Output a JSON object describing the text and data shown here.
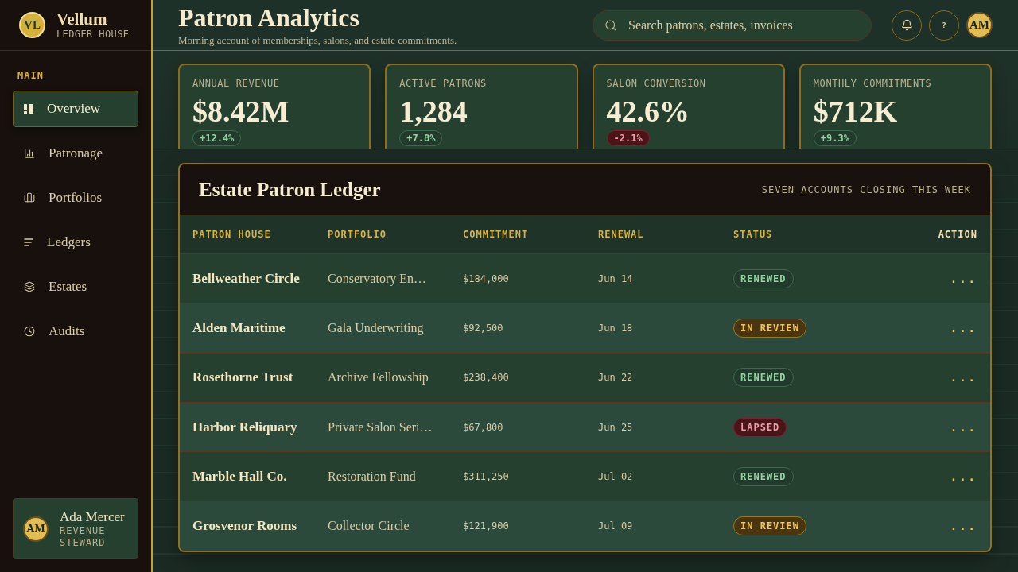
{
  "sidebar": {
    "logo": {
      "initials": "VL",
      "name": "Vellum",
      "tagline": "LEDGER HOUSE"
    },
    "section_label": "MAIN",
    "items": [
      {
        "label": "Overview",
        "selected": true
      },
      {
        "label": "Patronage",
        "selected": false
      },
      {
        "label": "Portfolios",
        "selected": false
      },
      {
        "label": "Ledgers",
        "selected": false
      },
      {
        "label": "Estates",
        "selected": false
      },
      {
        "label": "Audits",
        "selected": false
      }
    ],
    "user": {
      "initials": "AM",
      "name": "Ada Mercer",
      "role": "REVENUE STEWARD"
    }
  },
  "header": {
    "title": "Patron Analytics",
    "subtitle": "Morning account of memberships, salons, and estate commitments.",
    "search": {
      "placeholder": "Search patrons, estates, invoices"
    },
    "help_label": "?",
    "avatar_initials": "AM"
  },
  "kpis": [
    {
      "label": "ANNUAL REVENUE",
      "value": "$8.42M",
      "delta": {
        "text": "+12.4%",
        "kind": "up"
      }
    },
    {
      "label": "ACTIVE PATRONS",
      "value": "1,284",
      "delta": {
        "text": "+7.8%",
        "kind": "up"
      }
    },
    {
      "label": "SALON CONVERSION",
      "value": "42.6%",
      "delta": {
        "text": "-2.1%",
        "kind": "down"
      }
    },
    {
      "label": "MONTHLY COMMITMENTS",
      "value": "$712K",
      "delta": {
        "text": "+9.3%",
        "kind": "up"
      }
    }
  ],
  "ledger": {
    "title": "Estate Patron Ledger",
    "note": "SEVEN ACCOUNTS CLOSING THIS WEEK",
    "columns": [
      "PATRON HOUSE",
      "PORTFOLIO",
      "COMMITMENT",
      "RENEWAL",
      "STATUS",
      "ACTION"
    ],
    "rows": [
      {
        "patron": "Bellweather Circle",
        "portfolio": "Conservatory En…",
        "commitment": "$184,000",
        "renewal": "Jun 14",
        "status": {
          "label": "RENEWED",
          "kind": "renewed"
        },
        "action": "..."
      },
      {
        "patron": "Alden Maritime",
        "portfolio": "Gala Underwriting",
        "commitment": "$92,500",
        "renewal": "Jun 18",
        "status": {
          "label": "IN REVIEW",
          "kind": "review"
        },
        "action": "..."
      },
      {
        "patron": "Rosethorne Trust",
        "portfolio": "Archive Fellowship",
        "commitment": "$238,400",
        "renewal": "Jun 22",
        "status": {
          "label": "RENEWED",
          "kind": "renewed"
        },
        "action": "..."
      },
      {
        "patron": "Harbor Reliquary",
        "portfolio": "Private Salon Seri…",
        "commitment": "$67,800",
        "renewal": "Jun 25",
        "status": {
          "label": "LAPSED",
          "kind": "lapsed"
        },
        "action": "..."
      },
      {
        "patron": "Marble Hall Co.",
        "portfolio": "Restoration Fund",
        "commitment": "$311,250",
        "renewal": "Jul 02",
        "status": {
          "label": "RENEWED",
          "kind": "renewed"
        },
        "action": "..."
      },
      {
        "patron": "Grosvenor Rooms",
        "portfolio": "Collector Circle",
        "commitment": "$121,900",
        "renewal": "Jul 09",
        "status": {
          "label": "IN REVIEW",
          "kind": "review"
        },
        "action": "..."
      }
    ]
  }
}
